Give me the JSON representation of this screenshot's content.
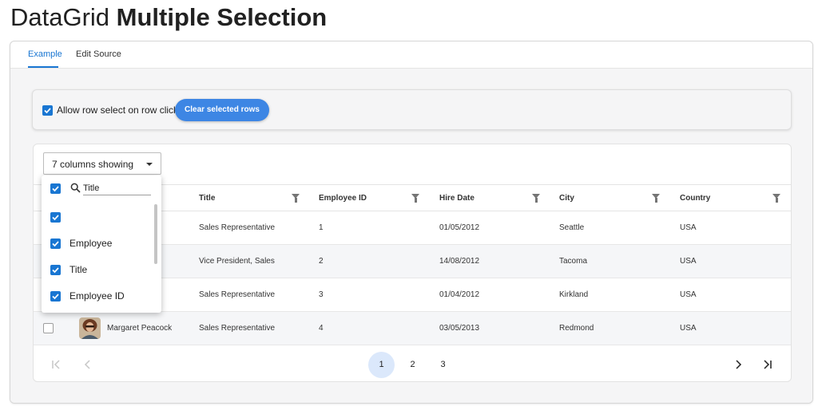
{
  "page": {
    "title_prefix": "DataGrid",
    "title_main": "Multiple Selection"
  },
  "tabs": [
    {
      "label": "Example",
      "active": true
    },
    {
      "label": "Edit Source",
      "active": false
    }
  ],
  "options": {
    "allow_row_select_label": "Allow row select on row click",
    "allow_row_select_checked": true,
    "clear_button_label": "Clear selected rows"
  },
  "grid": {
    "columns_toggle_label": "7 columns showing",
    "headers": [
      "Title",
      "Employee ID",
      "Hire Date",
      "City",
      "Country"
    ],
    "rows": [
      {
        "name": "",
        "title": "Sales Representative",
        "employee_id": "1",
        "hire_date": "01/05/2012",
        "city": "Seattle",
        "country": "USA",
        "selected": false
      },
      {
        "name": "",
        "title": "Vice President, Sales",
        "employee_id": "2",
        "hire_date": "14/08/2012",
        "city": "Tacoma",
        "country": "USA",
        "selected": false
      },
      {
        "name": "",
        "title": "Sales Representative",
        "employee_id": "3",
        "hire_date": "01/04/2012",
        "city": "Kirkland",
        "country": "USA",
        "selected": false
      },
      {
        "name": "Margaret Peacock",
        "title": "Sales Representative",
        "employee_id": "4",
        "hire_date": "03/05/2013",
        "city": "Redmond",
        "country": "USA",
        "selected": false
      }
    ],
    "pager": {
      "pages": [
        "1",
        "2",
        "3"
      ],
      "current_page": 1
    }
  },
  "column_dropdown": {
    "search_value": "Title",
    "items": [
      {
        "label": "",
        "checked": true
      },
      {
        "label": "Employee",
        "checked": true
      },
      {
        "label": "Title",
        "checked": true
      },
      {
        "label": "Employee ID",
        "checked": true
      }
    ]
  },
  "colors": {
    "accent": "#1976d2",
    "button": "#3d86e4",
    "active_page": "#dbe8fb"
  }
}
